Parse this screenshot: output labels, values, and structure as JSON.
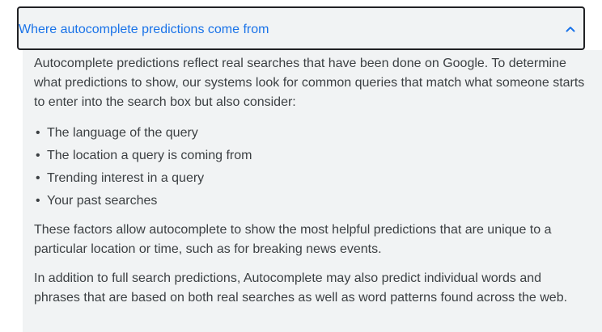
{
  "accordion": {
    "title": "Where autocomplete predictions come from",
    "expanded_icon": "chevron-up-icon",
    "accent_color": "#1a73e8",
    "paragraph_1": "Autocomplete predictions reflect real searches that have been done on Google. To determine what predictions to show, our systems look for common queries that match what someone starts to enter into the search box but also consider:",
    "bullets": [
      "The language of the query",
      "The location a query is coming from",
      "Trending interest in a query",
      "Your past searches"
    ],
    "paragraph_2": "These factors allow autocomplete to show the most helpful predictions that are unique to a particular location or time, such as for breaking news events.",
    "paragraph_3": "In addition to full search predictions, Autocomplete may also predict individual words and phrases that are based on both real searches as well as word patterns found across the web."
  }
}
